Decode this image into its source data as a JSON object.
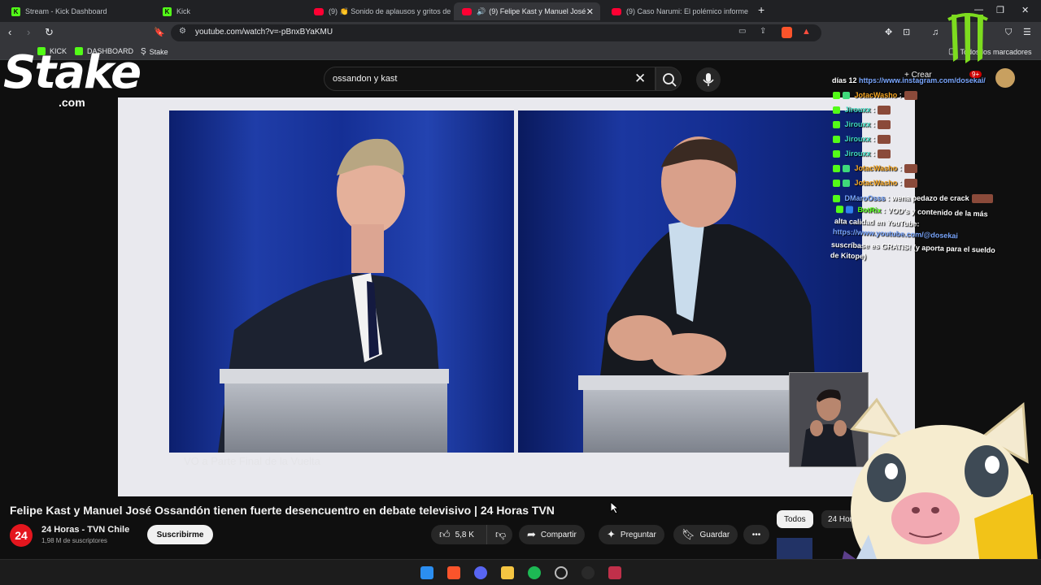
{
  "browser": {
    "tabs": [
      {
        "title": "Stream - Kick Dashboard",
        "icon": "kick"
      },
      {
        "title": "Kick",
        "icon": "kick"
      },
      {
        "title": "(9) 👏 Sonido de aplausos y gritos de",
        "icon": "youtube"
      },
      {
        "title": "(9) Felipe Kast y Manuel José",
        "icon": "youtube",
        "active": true
      },
      {
        "title": "(9) Caso Narumi: El polémico informe",
        "icon": "youtube"
      }
    ],
    "url": "youtube.com/watch?v=-pBnxBYaKMU",
    "bookmarks": [
      "KICK",
      "DASHBOARD",
      "Stake"
    ],
    "bookmarks_folder": "Todos los marcadores"
  },
  "youtube": {
    "search_query": "ossandon y kast",
    "create_label": "Crear",
    "notifications": "9+",
    "video_title": "Felipe Kast y Manuel José Ossandón tienen fuerte desencuentro en debate televisivo | 24 Horas TVN",
    "watermark": "VO a Parte Final de la Vuelta",
    "channel": {
      "avatar_text": "24",
      "name": "24 Horas - TVN Chile",
      "subscribers": "1,98 M de suscriptores",
      "subscribe_label": "Suscribirme"
    },
    "actions": {
      "likes": "5,8 K",
      "share": "Compartir",
      "ask": "Preguntar",
      "save": "Guardar"
    },
    "chips": [
      "Todos",
      "24 Horas"
    ]
  },
  "chat": {
    "header_prefix": "días 12",
    "header_link": "https://www.instagram.com/dosekai/",
    "messages": [
      {
        "user": "JotacWasho",
        "color": "#f5a623",
        "text": ":"
      },
      {
        "user": "Jirouxx",
        "color": "#3fd9c0",
        "text": ":"
      },
      {
        "user": "Jirouxx",
        "color": "#3fd9c0",
        "text": ":"
      },
      {
        "user": "Jirouxx",
        "color": "#3fd9c0",
        "text": ":"
      },
      {
        "user": "Jirouxx",
        "color": "#3fd9c0",
        "text": ":"
      },
      {
        "user": "JotacWasho",
        "color": "#f5a623",
        "text": ":"
      },
      {
        "user": "JotacWasho",
        "color": "#f5a623",
        "text": ":"
      },
      {
        "user": "DMaroOsss",
        "color": "#7aa7ff",
        "text": ": wena pedazo de crack"
      },
      {
        "user": "BotRix",
        "color": "#53fc18",
        "text": ": VOD's y contenido de la más"
      }
    ],
    "bot_line2": "alta calidad en YouTube:",
    "bot_link": "https://www.youtube.com/@dosekai",
    "bot_line3": "suscríbase es GRATIS! (y aporta para el sueldo",
    "bot_line4": "de Kitope)"
  },
  "overlay": {
    "stake_brand": "Stake",
    "stake_domain": ".com"
  }
}
